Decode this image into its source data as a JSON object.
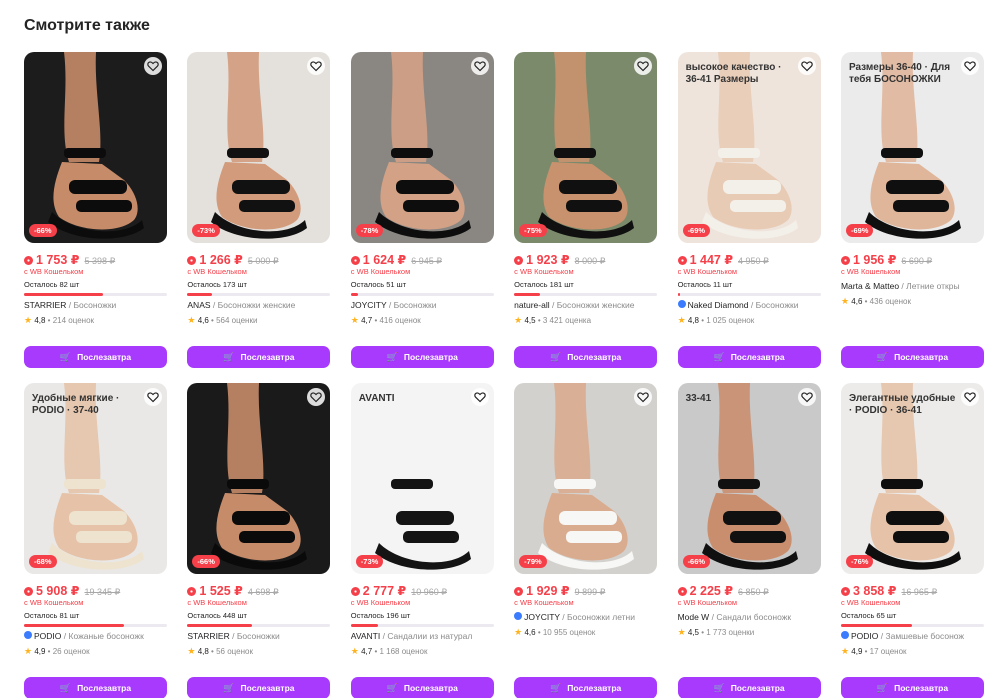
{
  "section_title": "Смотрите также",
  "common": {
    "wallet_label": "с WB Кошельком",
    "button_label": "Послезавтра",
    "accent": "#a73afd",
    "discount_color": "#f5404a"
  },
  "products": [
    {
      "discount": "-66%",
      "price": "1 753 ₽",
      "old_price": "5 398 ₽",
      "stock": "Осталось 82 шт",
      "stock_fill": 0.55,
      "brand": "STARRIER",
      "category": "Босоножки",
      "verified": false,
      "rating": "4,8",
      "reviews": "214 оценок",
      "bg": "#1c1c1c",
      "shoe": "#0c0c0c",
      "skin": "#c68c6a",
      "overlay": ""
    },
    {
      "discount": "-73%",
      "price": "1 266 ₽",
      "old_price": "5 000 ₽",
      "stock": "Осталось 173 шт",
      "stock_fill": 0.17,
      "brand": "ANAS",
      "category": "Босоножки женские",
      "verified": false,
      "rating": "4,6",
      "reviews": "564 оценки",
      "bg": "#e4e0dc",
      "shoe": "#111111",
      "skin": "#d29b7c",
      "overlay": ""
    },
    {
      "discount": "-78%",
      "price": "1 624 ₽",
      "old_price": "6 945 ₽",
      "stock": "Осталось 51 шт",
      "stock_fill": 0.05,
      "brand": "JOYCITY",
      "category": "Босоножки",
      "verified": false,
      "rating": "4,7",
      "reviews": "416 оценок",
      "bg": "#8a8783",
      "shoe": "#0d0d0d",
      "skin": "#d3a185",
      "overlay": ""
    },
    {
      "discount": "-75%",
      "price": "1 923 ₽",
      "old_price": "8 000 ₽",
      "stock": "Осталось 181 шт",
      "stock_fill": 0.18,
      "brand": "nature-all",
      "category": "Босоножки женские",
      "verified": false,
      "rating": "4,5",
      "reviews": "3 421 оценка",
      "bg": "#7c8a6c",
      "shoe": "#101010",
      "skin": "#c9926e",
      "overlay": ""
    },
    {
      "discount": "-69%",
      "price": "1 447 ₽",
      "old_price": "4 950 ₽",
      "stock": "Осталось 11 шт",
      "stock_fill": 0.02,
      "brand": "Naked Diamond",
      "category": "Босоножки",
      "verified": true,
      "rating": "4,8",
      "reviews": "1 025 оценок",
      "bg": "#efe4dc",
      "shoe": "#f3f0ea",
      "skin": "#e8cbb5",
      "overlay": "высокое качество · 36-41 Размеры"
    },
    {
      "discount": "-69%",
      "price": "1 956 ₽",
      "old_price": "6 690 ₽",
      "stock": "",
      "stock_fill": 0,
      "brand": "Marta & Matteo",
      "category": "Летние откры",
      "verified": false,
      "rating": "4,6",
      "reviews": "436 оценок",
      "bg": "#ebebeb",
      "shoe": "#0f0f0f",
      "skin": "#e0b69b",
      "overlay": "Размеры 36-40 · Для тебя БОСОНОЖКИ"
    },
    {
      "discount": "-68%",
      "price": "5 908 ₽",
      "old_price": "19 345 ₽",
      "stock": "Осталось 81 шт",
      "stock_fill": 0.7,
      "brand": "PODIO",
      "category": "Кожаные босоножк",
      "verified": true,
      "rating": "4,9",
      "reviews": "26 оценок",
      "bg": "#e9e8e6",
      "shoe": "#ede3cf",
      "skin": "#e6c3a8",
      "overlay": "Удобные мягкие · PODIO · 37-40"
    },
    {
      "discount": "-66%",
      "price": "1 525 ₽",
      "old_price": "4 698 ₽",
      "stock": "Осталось 448 шт",
      "stock_fill": 0.45,
      "brand": "STARRIER",
      "category": "Босоножки",
      "verified": false,
      "rating": "4,8",
      "reviews": "56 оценок",
      "bg": "#1a1a1a",
      "shoe": "#0a0a0a",
      "skin": "#c68c6a",
      "overlay": ""
    },
    {
      "discount": "-73%",
      "price": "2 777 ₽",
      "old_price": "10 960 ₽",
      "stock": "Осталось 196 шт",
      "stock_fill": 0.19,
      "brand": "AVANTI",
      "category": "Сандалии из натурал",
      "verified": false,
      "rating": "4,7",
      "reviews": "1 168 оценок",
      "bg": "#f4f4f4",
      "shoe": "#141414",
      "skin": "#f4f4f4",
      "overlay": "AVANTI"
    },
    {
      "discount": "-79%",
      "price": "1 929 ₽",
      "old_price": "9 899 ₽",
      "stock": "",
      "stock_fill": 0,
      "brand": "JOYCITY",
      "category": "Босоножки летни",
      "verified": true,
      "rating": "4,6",
      "reviews": "10 955 оценок",
      "bg": "#d3d1cd",
      "shoe": "#f7f7f5",
      "skin": "#d9ab8f",
      "overlay": ""
    },
    {
      "discount": "-66%",
      "price": "2 225 ₽",
      "old_price": "6 850 ₽",
      "stock": "",
      "stock_fill": 0,
      "brand": "Mode W",
      "category": "Сандали босоножк",
      "verified": false,
      "rating": "4,5",
      "reviews": "1 773 оценки",
      "bg": "#c9c9c9",
      "shoe": "#101010",
      "skin": "#c98e6e",
      "overlay": "33-41"
    },
    {
      "discount": "-76%",
      "price": "3 858 ₽",
      "old_price": "16 965 ₽",
      "stock": "Осталось 65 шт",
      "stock_fill": 0.5,
      "brand": "PODIO",
      "category": "Замшевые босонож",
      "verified": true,
      "rating": "4,9",
      "reviews": "17 оценок",
      "bg": "#ecebea",
      "shoe": "#0e0e0e",
      "skin": "#e6c3a8",
      "overlay": "Элегантные удобные · PODIO · 36-41"
    }
  ]
}
